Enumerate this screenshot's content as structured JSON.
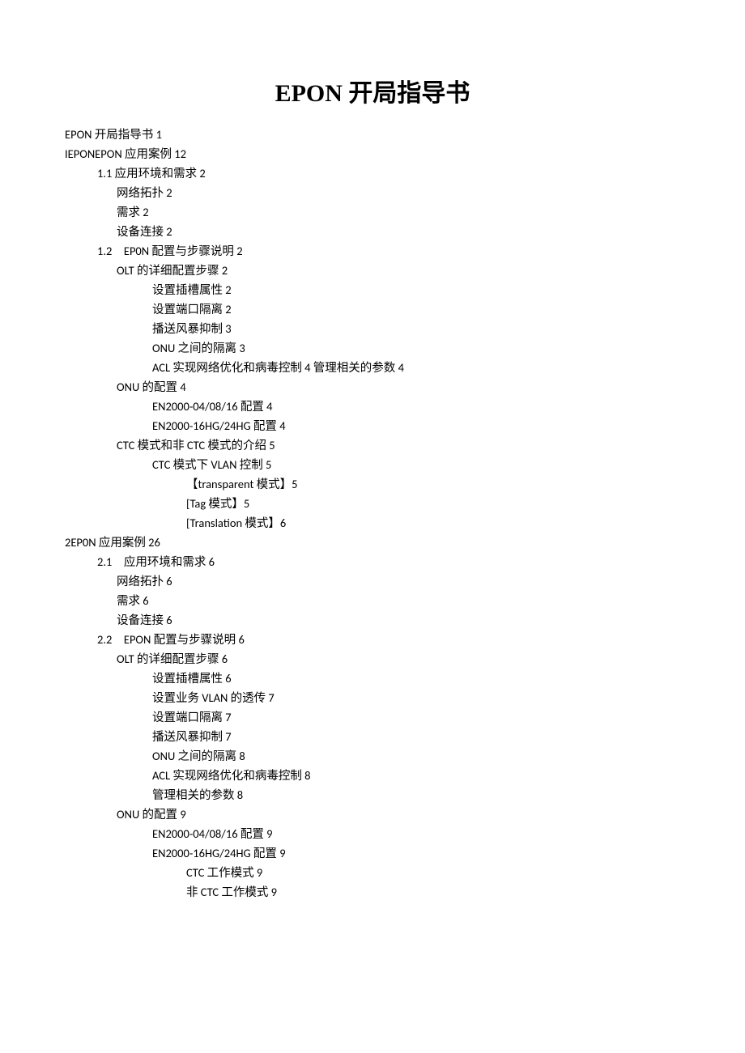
{
  "title": "EPON 开局指导书",
  "toc": [
    {
      "level": 0,
      "text": "EPON 开局指导书 1"
    },
    {
      "level": 0,
      "text": "IEPONEPON 应用案例 12"
    },
    {
      "level": 1,
      "text": "1.1 应用环境和需求 2"
    },
    {
      "level": 2,
      "text": "网络拓扑 2"
    },
    {
      "level": 2,
      "text": "需求 2"
    },
    {
      "level": 2,
      "text": "设备连接 2"
    },
    {
      "level": 1,
      "text": "1.2　EP0N 配置与步骤说明 2"
    },
    {
      "level": 2,
      "text": "OLT 的详细配置步骤 2"
    },
    {
      "level": 3,
      "text": "设置插槽属性 2"
    },
    {
      "level": 3,
      "text": "设置端口隔离 2"
    },
    {
      "level": 3,
      "text": "播送风暴抑制 3"
    },
    {
      "level": 3,
      "text": "ONU 之间的隔离 3"
    },
    {
      "level": 3,
      "text": "ACL 实现网络优化和病毒控制 4 管理相关的参数 4"
    },
    {
      "level": 2,
      "text": "ONU 的配置 4"
    },
    {
      "level": 3,
      "text": "EN2000-04/08/16 配置 4"
    },
    {
      "level": 3,
      "text": "EN2000-16HG/24HG 配置 4"
    },
    {
      "level": 2,
      "text": "CTC 模式和非 CTC 模式的介绍 5"
    },
    {
      "level": 3,
      "text": "CTC 模式下 VLAN 控制 5"
    },
    {
      "level": 4,
      "text": "【transparent 模式】5"
    },
    {
      "level": 4,
      "text": "[Tag 模式】5"
    },
    {
      "level": 4,
      "text": "[Translation 模式】6"
    },
    {
      "level": 0,
      "text": "2EP0N 应用案例 26"
    },
    {
      "level": 1,
      "text": "2.1　应用环境和需求 6"
    },
    {
      "level": 2,
      "text": "网络拓扑 6"
    },
    {
      "level": 2,
      "text": "需求 6"
    },
    {
      "level": 2,
      "text": "设备连接 6"
    },
    {
      "level": 1,
      "text": "2.2　EPON 配置与步骤说明 6"
    },
    {
      "level": 2,
      "text": "OLT 的详细配置步骤 6"
    },
    {
      "level": 3,
      "text": "设置插槽属性 6"
    },
    {
      "level": 3,
      "text": "设置业务 VLAN 的透传 7"
    },
    {
      "level": 3,
      "text": "设置端口隔离 7"
    },
    {
      "level": 3,
      "text": "播送风暴抑制 7"
    },
    {
      "level": 3,
      "text": "ONU 之间的隔离 8"
    },
    {
      "level": 3,
      "text": "ACL 实现网络优化和病毒控制 8"
    },
    {
      "level": 3,
      "text": "管理相关的参数 8"
    },
    {
      "level": 2,
      "text": "ONU 的配置 9"
    },
    {
      "level": 3,
      "text": "EN2000-04/08/16 配置 9"
    },
    {
      "level": 3,
      "text": "EN2000-16HG/24HG 配置 9"
    },
    {
      "level": 4,
      "text": "CTC 工作模式 9"
    },
    {
      "level": 4,
      "text": "非 CTC 工作模式 9"
    }
  ]
}
